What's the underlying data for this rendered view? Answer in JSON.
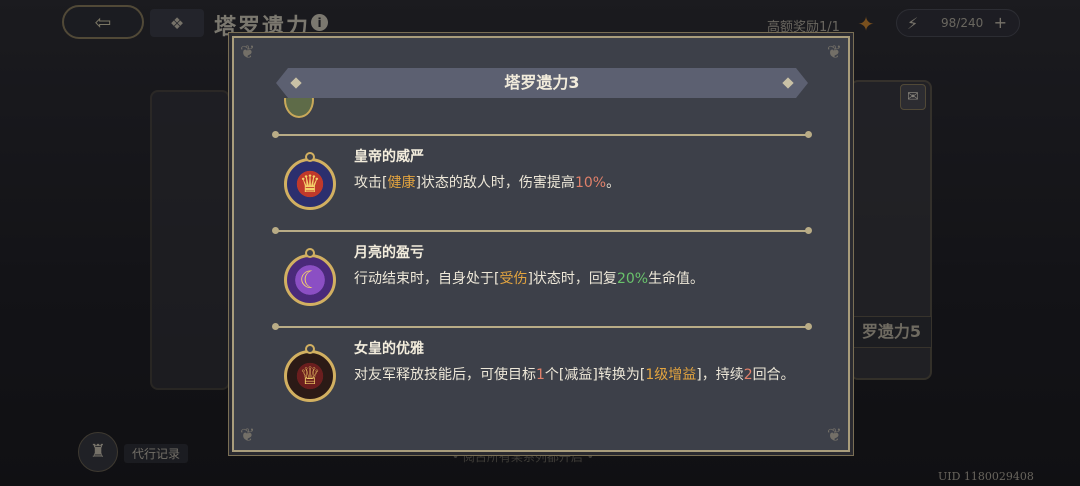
{
  "topbar": {
    "back_icon": "arrow-back-icon",
    "menu_icon": "grid-icon",
    "title": "塔罗遗力",
    "info_icon": "info-icon",
    "reward_text": "高额奖励1/1",
    "reward_icon": "crest-icon",
    "energy_text": "98/240",
    "energy_plus": "+"
  },
  "background": {
    "right_card_label": "罗遗力5",
    "record_label": "代行记录",
    "bottom_hint": "• 阅古所有某系列都开启 •",
    "uid": "UID 1180029408"
  },
  "modal": {
    "title": "塔罗遗力3",
    "skills": [
      {
        "name": "皇帝的威严",
        "icon": "emperor-crown-badge-icon",
        "desc_parts": [
          "攻击[",
          "健康",
          "]状态的敌人时，伤害提高",
          "10%",
          "。"
        ]
      },
      {
        "name": "月亮的盈亏",
        "icon": "moon-badge-icon",
        "desc_parts": [
          "行动结束时，自身处于[",
          "受伤",
          "]状态时，回复",
          "20%",
          "生命值。"
        ]
      },
      {
        "name": "女皇的优雅",
        "icon": "empress-crown-badge-icon",
        "desc_parts": [
          "对友军释放技能后，可使目标",
          "1",
          "个[减益]转换为[",
          "1级增益",
          "]，持续",
          "2",
          "回合。"
        ]
      }
    ]
  },
  "colors": {
    "highlight_orange": "#e3a43f",
    "highlight_red": "#e0806a",
    "highlight_green": "#69c26b",
    "frame_gold": "#a99d7c"
  }
}
